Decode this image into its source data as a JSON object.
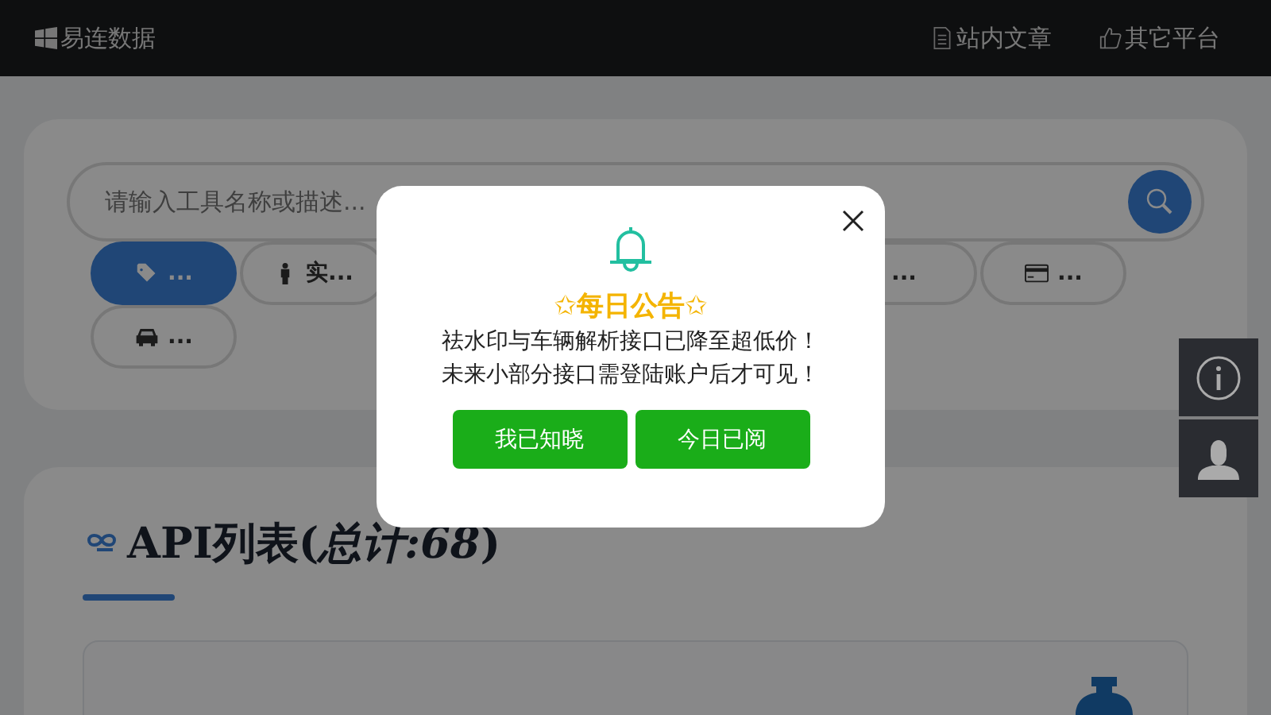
{
  "navbar": {
    "brand": "易连数据",
    "links": [
      {
        "label": "站内文章",
        "kind": "document"
      },
      {
        "label": "其它平台",
        "kind": "thumb"
      }
    ]
  },
  "search": {
    "placeholder": "请输入工具名称或描述..."
  },
  "chips_row1": [
    {
      "label": "...",
      "kind": "tag",
      "selected": true
    },
    {
      "label": "实...",
      "kind": "person",
      "selected": false
    }
  ],
  "chips_row1_right": [
    {
      "label": "...",
      "kind": "plain",
      "selected": false
    },
    {
      "label": "...",
      "kind": "card",
      "selected": false
    }
  ],
  "chips_row2": [
    {
      "label": "...",
      "kind": "car",
      "selected": false
    }
  ],
  "api_section": {
    "title": "API列表(*总计:68*)"
  },
  "dialog": {
    "title": "✩每日公告✩",
    "lines": [
      "祛水印与车辆解析接口已降至超低价！",
      "未来小部分接口需登陆账户后才可见！"
    ],
    "buttons": [
      "我已知晓",
      "今日已阅"
    ]
  }
}
